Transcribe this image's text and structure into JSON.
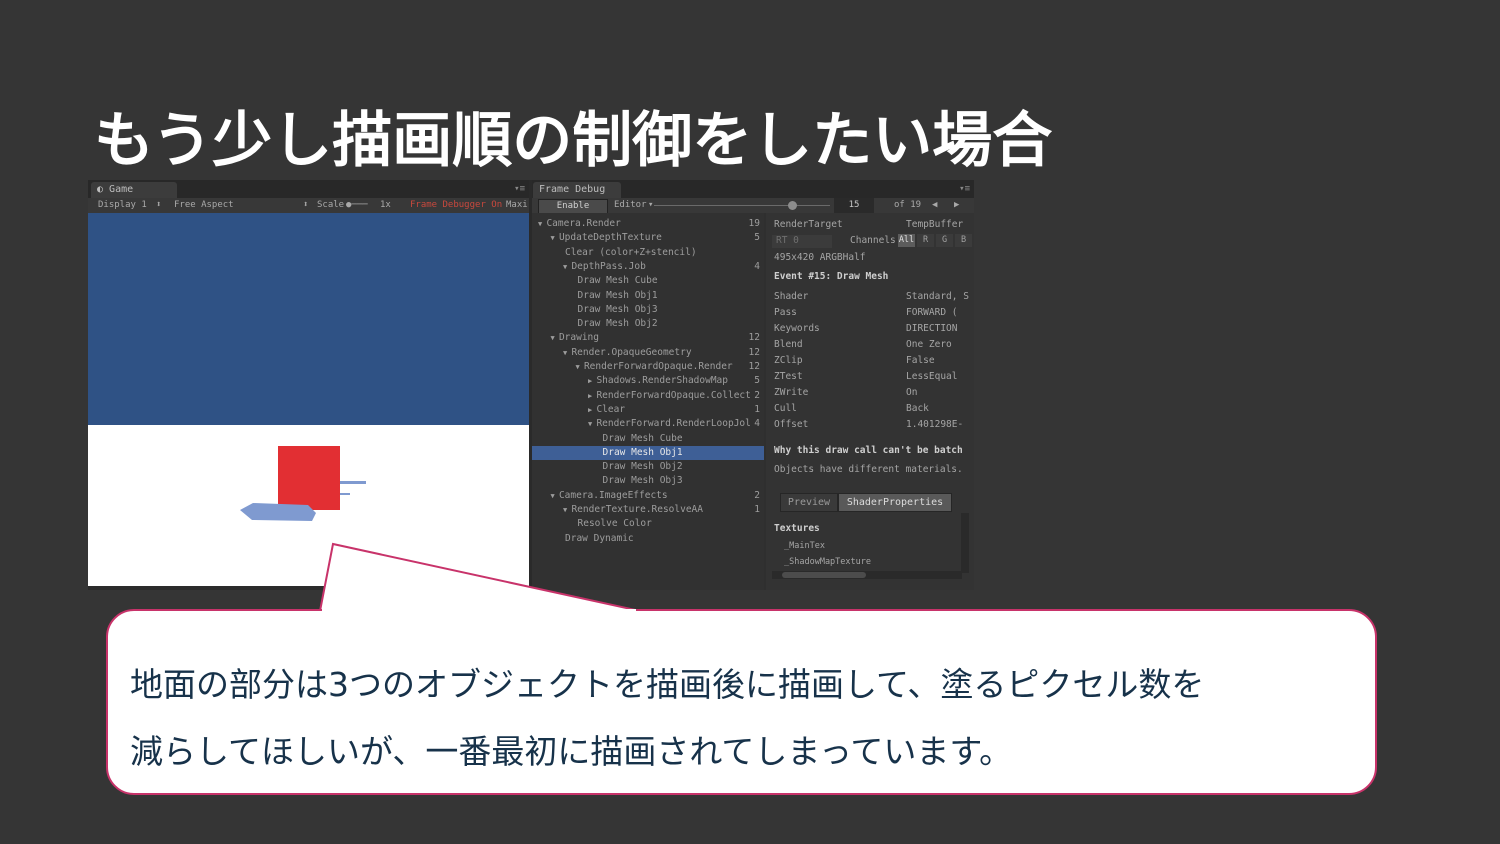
{
  "title": "もう少し描画順の制御をしたい場合",
  "game": {
    "tab": "Game",
    "display": "Display 1",
    "aspect": "Free Aspect",
    "scale_label": "Scale",
    "scale_value": "1x",
    "frame_debugger_on": "Frame Debugger On",
    "maximize": "Maxi"
  },
  "frame_debug": {
    "tab": "Frame Debug",
    "enable_button": "Enable",
    "editor_label": "Editor",
    "event_index": "15",
    "event_total": "of 19",
    "tree": [
      {
        "label": "Camera.Render",
        "count": "19",
        "indent": 0,
        "arrow": "▼"
      },
      {
        "label": "UpdateDepthTexture",
        "count": "5",
        "indent": 1,
        "arrow": "▼"
      },
      {
        "label": "Clear (color+Z+stencil)",
        "count": "",
        "indent": 2,
        "arrow": ""
      },
      {
        "label": "DepthPass.Job",
        "count": "4",
        "indent": 2,
        "arrow": "▼"
      },
      {
        "label": "Draw Mesh Cube",
        "count": "",
        "indent": 3,
        "arrow": ""
      },
      {
        "label": "Draw Mesh Obj1",
        "count": "",
        "indent": 3,
        "arrow": ""
      },
      {
        "label": "Draw Mesh Obj3",
        "count": "",
        "indent": 3,
        "arrow": ""
      },
      {
        "label": "Draw Mesh Obj2",
        "count": "",
        "indent": 3,
        "arrow": ""
      },
      {
        "label": "Drawing",
        "count": "12",
        "indent": 1,
        "arrow": "▼"
      },
      {
        "label": "Render.OpaqueGeometry",
        "count": "12",
        "indent": 2,
        "arrow": "▼"
      },
      {
        "label": "RenderForwardOpaque.Render",
        "count": "12",
        "indent": 3,
        "arrow": "▼"
      },
      {
        "label": "Shadows.RenderShadowMap",
        "count": "5",
        "indent": 4,
        "arrow": "▶"
      },
      {
        "label": "RenderForwardOpaque.Collect",
        "count": "2",
        "indent": 4,
        "arrow": "▶"
      },
      {
        "label": "Clear",
        "count": "1",
        "indent": 4,
        "arrow": "▶"
      },
      {
        "label": "RenderForward.RenderLoopJol",
        "count": "4",
        "indent": 4,
        "arrow": "▼"
      },
      {
        "label": "Draw Mesh Cube",
        "count": "",
        "indent": 5,
        "arrow": ""
      },
      {
        "label": "Draw Mesh Obj1",
        "count": "",
        "indent": 5,
        "arrow": "",
        "selected": true
      },
      {
        "label": "Draw Mesh Obj2",
        "count": "",
        "indent": 5,
        "arrow": ""
      },
      {
        "label": "Draw Mesh Obj3",
        "count": "",
        "indent": 5,
        "arrow": ""
      },
      {
        "label": "Camera.ImageEffects",
        "count": "2",
        "indent": 1,
        "arrow": "▼"
      },
      {
        "label": "RenderTexture.ResolveAA",
        "count": "1",
        "indent": 2,
        "arrow": "▼"
      },
      {
        "label": "Resolve Color",
        "count": "",
        "indent": 3,
        "arrow": ""
      },
      {
        "label": "Draw Dynamic",
        "count": "",
        "indent": 2,
        "arrow": ""
      }
    ],
    "details": {
      "render_target_label": "RenderTarget",
      "render_target_value": "TempBuffer",
      "rt_label": "RT 0",
      "channels_label": "Channels",
      "channels": [
        "All",
        "R",
        "G",
        "B"
      ],
      "format": "495x420 ARGBHalf",
      "event_title": "Event #15: Draw Mesh",
      "properties": [
        {
          "key": "Shader",
          "value": "Standard, S"
        },
        {
          "key": "Pass",
          "value": "FORWARD ("
        },
        {
          "key": "Keywords",
          "value": "DIRECTION"
        },
        {
          "key": "Blend",
          "value": "One Zero"
        },
        {
          "key": "ZClip",
          "value": "False"
        },
        {
          "key": "ZTest",
          "value": "LessEqual"
        },
        {
          "key": "ZWrite",
          "value": "On"
        },
        {
          "key": "Cull",
          "value": "Back"
        },
        {
          "key": "Offset",
          "value": "1.401298E-"
        }
      ],
      "batch_title": "Why this draw call can't be batch",
      "batch_reason": "Objects have different materials.",
      "tab_preview": "Preview",
      "tab_shader_properties": "ShaderProperties",
      "textures_title": "Textures",
      "textures": [
        "_MainTex",
        "_ShadowMapTexture"
      ]
    }
  },
  "callout": {
    "line1": "地面の部分は3つのオブジェクトを描画後に描画して、塗るピクセル数を",
    "line2": "減らしてほしいが、一番最初に描画されてしまっています。"
  },
  "colors": {
    "background": "#353535",
    "sky": "#2f5285",
    "cube": "#e22f33",
    "selection": "#3e5f96",
    "callout_border": "#c8336a",
    "callout_text": "#17324a"
  }
}
